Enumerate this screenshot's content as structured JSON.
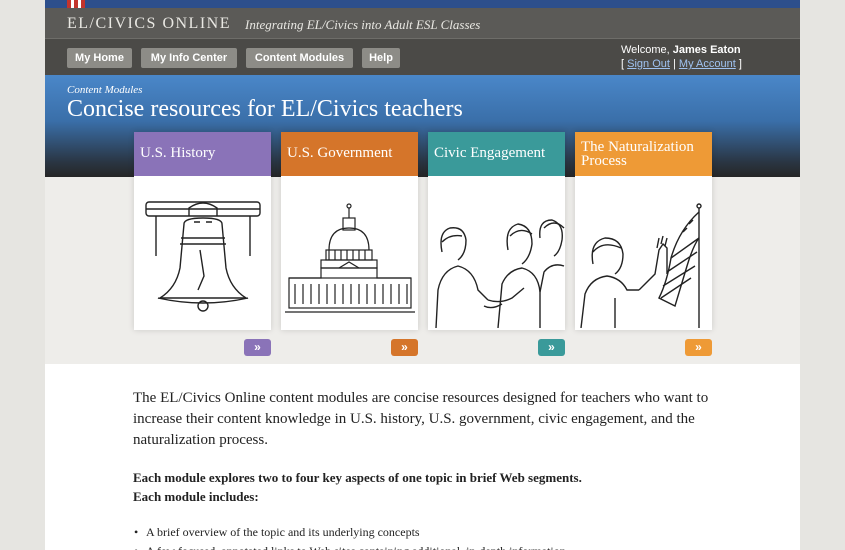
{
  "header": {
    "site_name": "EL/CIVICS ONLINE",
    "tagline": "Integrating EL/Civics into Adult ESL Classes"
  },
  "nav": {
    "items": [
      "My Home",
      "My Info Center",
      "Content Modules",
      "Help"
    ]
  },
  "user": {
    "welcome_prefix": "Welcome,",
    "name": "James Eaton",
    "bracket_open": "[",
    "sign_out": "Sign Out",
    "separator": "|",
    "my_account": "My Account",
    "bracket_close": "]"
  },
  "hero": {
    "subtitle": "Content Modules",
    "title": "Concise resources for EL/Civics teachers"
  },
  "modules": [
    {
      "title": "U.S. History",
      "color": "#8a73b8",
      "icon": "liberty-bell-illustration",
      "arrow": "»"
    },
    {
      "title": "U.S. Government",
      "color": "#d5752a",
      "icon": "capitol-building-illustration",
      "arrow": "»"
    },
    {
      "title": "Civic Engagement",
      "color": "#3a9a9a",
      "icon": "handshake-illustration",
      "arrow": "»"
    },
    {
      "title": "The Naturalization Process",
      "color": "#ee9a36",
      "icon": "oath-flag-illustration",
      "arrow": "»"
    }
  ],
  "body": {
    "intro": "The EL/Civics Online content modules are concise resources designed for teachers who want to increase their content knowledge in U.S. history, U.S. government, civic engagement, and the naturalization process.",
    "bold_1": "Each module explores two to four key aspects of one topic in brief Web segments.",
    "bold_2": "Each module includes:",
    "bullets": [
      "A brief overview of the topic and its underlying concepts",
      "A few focused, annotated links to Web sites containing additional, in-depth information."
    ]
  }
}
